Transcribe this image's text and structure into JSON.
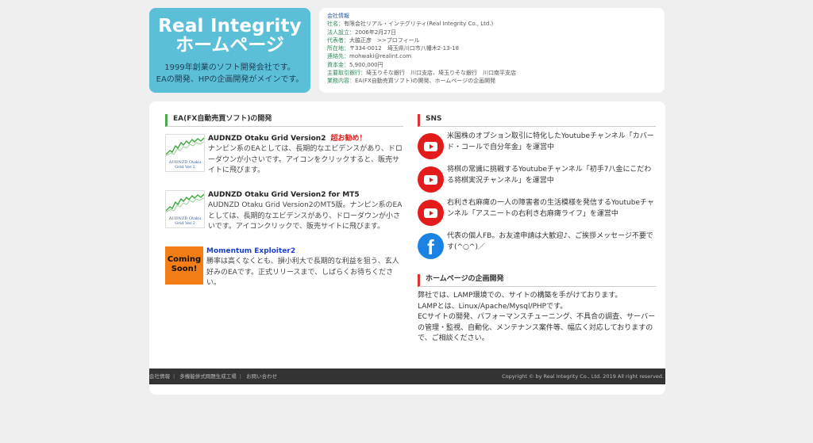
{
  "logo": {
    "title_line1": "Real Integrity",
    "title_line2": "ホームページ",
    "tagline1": "1999年創業のソフト開発会社です。",
    "tagline2": "EAの開発、HPの企画開発がメインです。"
  },
  "company": {
    "title": "会社情報",
    "rows": [
      {
        "k": "社名：",
        "v": "有限会社リアル・インテグリティ(Real Integrity Co., Ltd.)"
      },
      {
        "k": "法人設立：",
        "v": "2006年2月27日"
      },
      {
        "k": "代表者：",
        "v": "大脇正彦　>>プロフィール"
      },
      {
        "k": "所在地：",
        "v": "〒334-0012　埼玉県川口市八幡木2-13-18"
      },
      {
        "k": "連絡先：",
        "v": "mohwaki@realint.com"
      },
      {
        "k": "資本金：",
        "v": "5,900,000円"
      },
      {
        "k": "主要取引銀行：",
        "v": "埼玉りそな銀行　川口支店、埼玉りそな銀行　川口南平支店"
      },
      {
        "k": "業務内容：",
        "v": "EA(FX自動売買ソフト)の開発、ホームページの企画開発"
      }
    ]
  },
  "ea_section": {
    "heading": "EA(FX自動売買ソフト)の開発",
    "items": [
      {
        "icon_caption": "AUDNZD Otaku Grid Ver.2",
        "title": "AUDNZD Otaku Grid Version2",
        "badge": "超お勧め！",
        "desc": "ナンピン系のEAとしては、長期的なエビデンスがあり、ドローダウンが小さいです。アイコンをクリックすると、販売サイトに飛びます。"
      },
      {
        "icon_caption": "AUDNZD Otaku Grid Ver.2",
        "title": "AUDNZD Otaku Grid Version2 for MT5",
        "badge": "",
        "desc": "AUDNZD Otaku Grid Version2のMT5版。ナンピン系のEAとしては、長期的なエビデンスがあり、ドローダウンが小さいです。アイコンクリックで、販売サイトに飛びます。"
      },
      {
        "icon_label_1": "Coming",
        "icon_label_2": "Soon!",
        "title": "Momentum Exploiter2",
        "badge": "",
        "desc": "勝率は高くなくとも、損小利大で長期的な利益を狙う、玄人好みのEAです。正式リリースまで、しばらくお待ちください。"
      }
    ]
  },
  "sns_section": {
    "heading": "SNS",
    "items": [
      {
        "icon": "youtube-icon",
        "text": "米国株のオプション取引に特化したYoutubeチャンネル「カバード・コールで自分年金」を運営中"
      },
      {
        "icon": "youtube-icon",
        "text": "将棋の常識に挑戦するYoutubeチャンネル「初手7八金にこだわる将棋実況チャンネル」を運営中"
      },
      {
        "icon": "youtube-icon",
        "text": "右利き右麻痺の一人の障害者の生活模様を発信するYoutubeチャンネル「アスニートの右利き右麻痺ライフ」を運営中"
      },
      {
        "icon": "facebook-icon",
        "text": "代表の個人FB。お友達申請は大歓迎♪、ご挨拶メッセージ不要です(^○^)／"
      }
    ]
  },
  "web_section": {
    "heading": "ホームページの企画開発",
    "lines": [
      "弊社では、LAMP環境での、サイトの構築を手がけております。",
      "LAMPとは、Linux/Apache/Mysql/PHPです。",
      "ECサイトの開発、パフォーマンスチューニング、不具合の調査、サーバーの管理・監視、自動化、メンテナンス案件等、幅広く対応しておりますので、ご相談ください。"
    ]
  },
  "footer": {
    "links": [
      "会社情報",
      "多機能併式問題生成工場",
      "お問い合わせ"
    ],
    "copyright": "Copyright © by Real Integrity Co., Ltd. 2019 All right reserved."
  },
  "colors": {
    "logo_bg": "#5cbfd8",
    "accent_green": "#4aa84a",
    "accent_red": "#d33333",
    "youtube": "#e31b1b",
    "facebook": "#1a82e2",
    "coming_soon": "#f57d16"
  }
}
